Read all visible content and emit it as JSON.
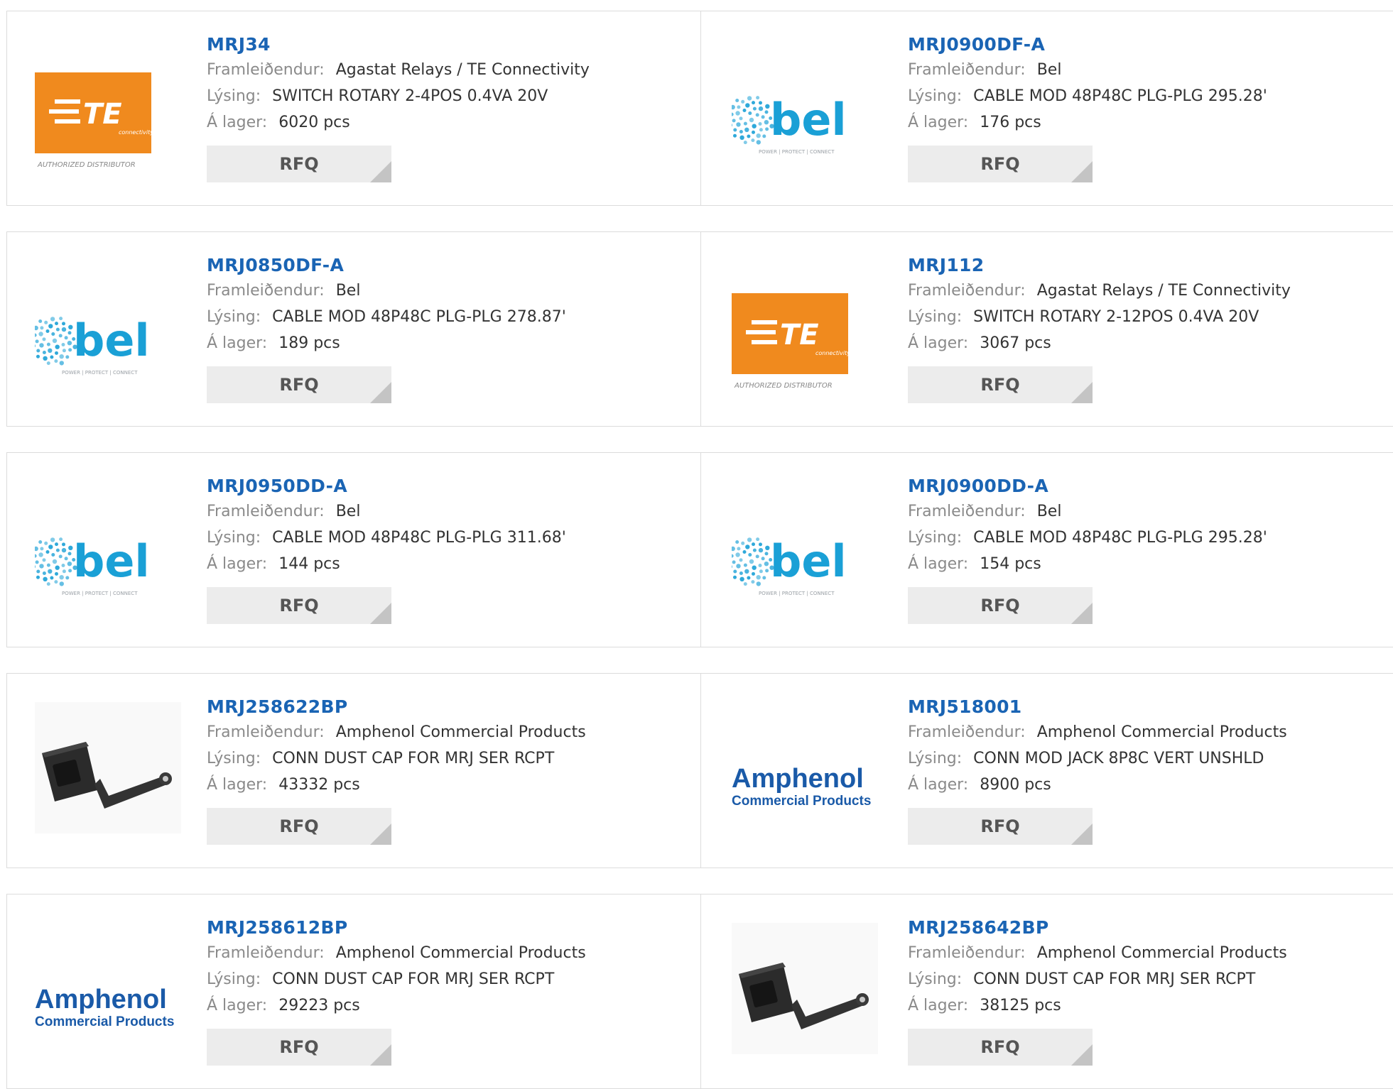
{
  "labels": {
    "manufacturer": "Framleiðendur:",
    "description": "Lýsing:",
    "stock": "Á lager:",
    "rfq": "RFQ"
  },
  "colors": {
    "part_link": "#1a64b4",
    "te_orange": "#f08a1e",
    "bel_blue": "#1aa0d6",
    "amphenol_blue": "#1a5aa8",
    "rfq_bg": "#ececec"
  },
  "logo_text": {
    "te": {
      "mark": "TE",
      "sub": "connectivity",
      "tag": "AUTHORIZED DISTRIBUTOR"
    },
    "bel": {
      "mark": "bel",
      "tag": "POWER | PROTECT | CONNECT"
    },
    "amphenol": {
      "mark": "Amphenol",
      "sub": "Commercial Products"
    }
  },
  "products": [
    {
      "part": "MRJ34",
      "logo": "te-logo",
      "manufacturer": "Agastat Relays / TE Connectivity",
      "description": "SWITCH ROTARY 2-4POS 0.4VA 20V",
      "stock": "6020 pcs"
    },
    {
      "part": "MRJ0900DF-A",
      "logo": "bel-logo",
      "manufacturer": "Bel",
      "description": "CABLE MOD 48P48C PLG-PLG 295.28'",
      "stock": "176 pcs"
    },
    {
      "part": "MRJ0850DF-A",
      "logo": "bel-logo",
      "manufacturer": "Bel",
      "description": "CABLE MOD 48P48C PLG-PLG 278.87'",
      "stock": "189 pcs"
    },
    {
      "part": "MRJ112",
      "logo": "te-logo",
      "manufacturer": "Agastat Relays / TE Connectivity",
      "description": "SWITCH ROTARY 2-12POS 0.4VA 20V",
      "stock": "3067 pcs"
    },
    {
      "part": "MRJ0950DD-A",
      "logo": "bel-logo",
      "manufacturer": "Bel",
      "description": "CABLE MOD 48P48C PLG-PLG 311.68'",
      "stock": "144 pcs"
    },
    {
      "part": "MRJ0900DD-A",
      "logo": "bel-logo",
      "manufacturer": "Bel",
      "description": "CABLE MOD 48P48C PLG-PLG 295.28'",
      "stock": "154 pcs"
    },
    {
      "part": "MRJ258622BP",
      "logo": "dust-cap-photo",
      "manufacturer": "Amphenol Commercial Products",
      "description": "CONN DUST CAP FOR MRJ SER RCPT",
      "stock": "43332 pcs"
    },
    {
      "part": "MRJ518001",
      "logo": "amphenol-logo",
      "manufacturer": "Amphenol Commercial Products",
      "description": "CONN MOD JACK 8P8C VERT UNSHLD",
      "stock": "8900 pcs"
    },
    {
      "part": "MRJ258612BP",
      "logo": "amphenol-logo",
      "manufacturer": "Amphenol Commercial Products",
      "description": "CONN DUST CAP FOR MRJ SER RCPT",
      "stock": "29223 pcs"
    },
    {
      "part": "MRJ258642BP",
      "logo": "dust-cap-photo",
      "manufacturer": "Amphenol Commercial Products",
      "description": "CONN DUST CAP FOR MRJ SER RCPT",
      "stock": "38125 pcs"
    }
  ]
}
